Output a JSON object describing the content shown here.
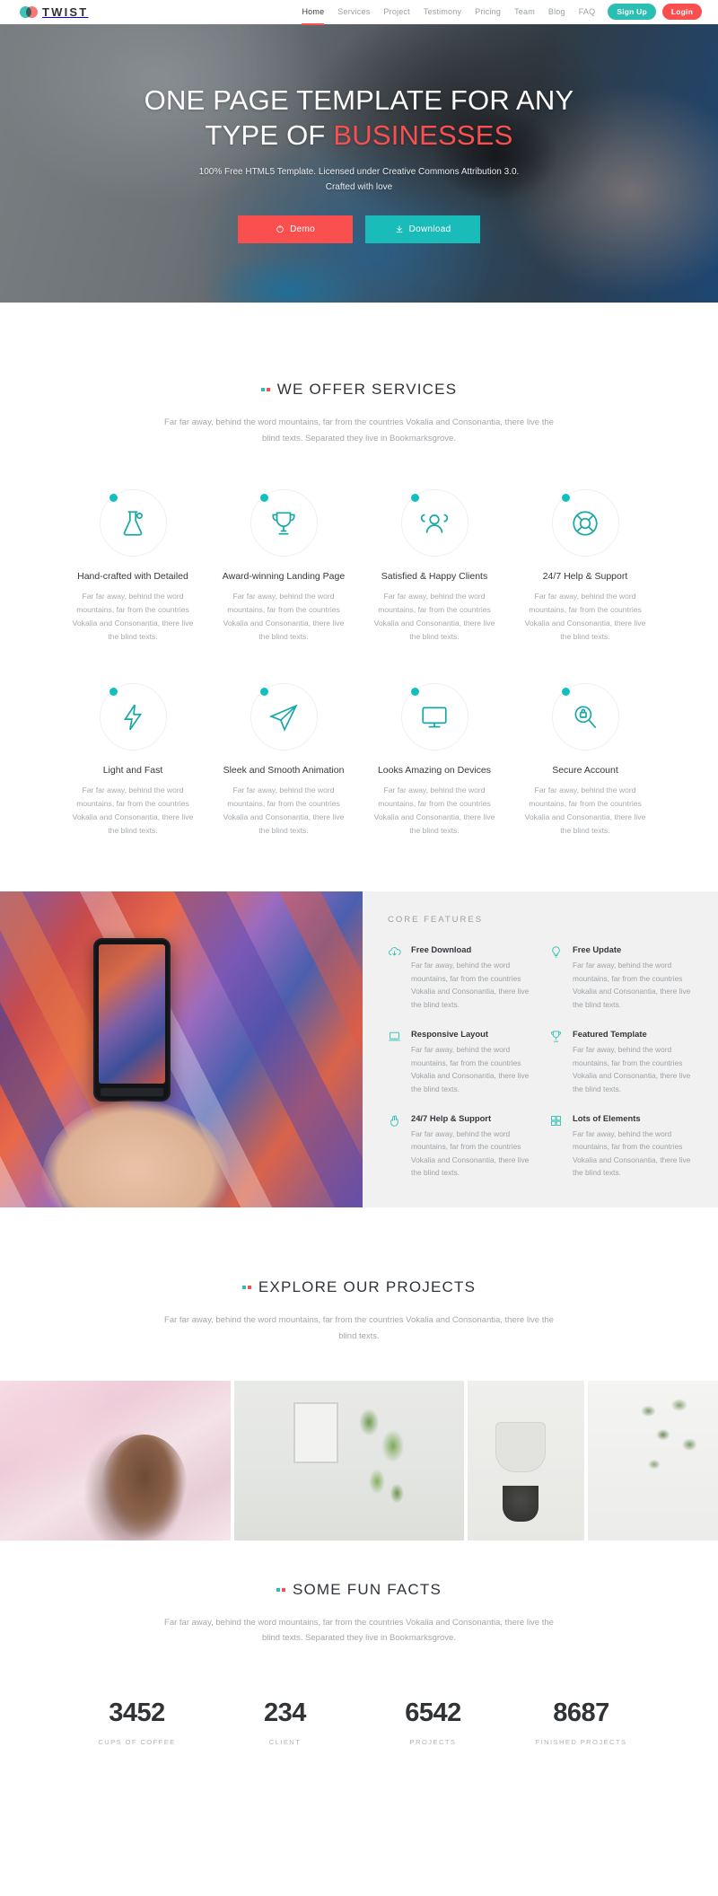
{
  "nav": {
    "brand": "TWIST",
    "links": [
      {
        "label": "Home",
        "active": true
      },
      {
        "label": "Services",
        "active": false
      },
      {
        "label": "Project",
        "active": false
      },
      {
        "label": "Testimony",
        "active": false
      },
      {
        "label": "Pricing",
        "active": false
      },
      {
        "label": "Team",
        "active": false
      },
      {
        "label": "Blog",
        "active": false
      },
      {
        "label": "FAQ",
        "active": false
      }
    ],
    "signup_label": "Sign Up",
    "login_label": "Login",
    "signup_color": "#2bbfb3",
    "login_color": "#f9504f"
  },
  "hero": {
    "title_line1": "ONE PAGE TEMPLATE FOR ANY",
    "title_line2_pre": "TYPE OF ",
    "title_line2_accent": "BUSINESSES",
    "sub_line1": "100% Free HTML5 Template. Licensed under Creative Commons Attribution 3.0.",
    "sub_line2": "Crafted with love",
    "demo_label": "Demo",
    "download_label": "Download",
    "demo_color": "#f9504f",
    "download_color": "#19bcb8"
  },
  "services": {
    "title": "WE OFFER SERVICES",
    "desc_line1": "Far far away, behind the word mountains, far from the countries Vokalia and Consonantia,",
    "desc_line2": "there live the blind texts. Separated they live in Bookmarksgrove.",
    "items": [
      {
        "icon": "flask-icon",
        "name": "Hand-crafted with Detailed",
        "text": "Far far away, behind the word mountains, far from the countries Vokalia and Consonantia, there live the blind texts."
      },
      {
        "icon": "trophy-icon",
        "name": "Award-winning Landing Page",
        "text": "Far far away, behind the word mountains, far from the countries Vokalia and Consonantia, there live the blind texts."
      },
      {
        "icon": "users-icon",
        "name": "Satisfied & Happy Clients",
        "text": "Far far away, behind the word mountains, far from the countries Vokalia and Consonantia, there live the blind texts."
      },
      {
        "icon": "lifebuoy-icon",
        "name": "24/7 Help & Support",
        "text": "Far far away, behind the word mountains, far from the countries Vokalia and Consonantia, there live the blind texts."
      },
      {
        "icon": "bolt-icon",
        "name": "Light and Fast",
        "text": "Far far away, behind the word mountains, far from the countries Vokalia and Consonantia, there live the blind texts."
      },
      {
        "icon": "paper-plane-icon",
        "name": "Sleek and Smooth Animation",
        "text": "Far far away, behind the word mountains, far from the countries Vokalia and Consonantia, there live the blind texts."
      },
      {
        "icon": "monitor-icon",
        "name": "Looks Amazing on Devices",
        "text": "Far far away, behind the word mountains, far from the countries Vokalia and Consonantia, there live the blind texts."
      },
      {
        "icon": "magnifier-lock-icon",
        "name": "Secure Account",
        "text": "Far far away, behind the word mountains, far from the countries Vokalia and Consonantia, there live the blind texts."
      }
    ]
  },
  "core": {
    "title": "CORE FEATURES",
    "features": [
      {
        "icon": "cloud-download-icon",
        "name": "Free Download",
        "text": "Far far away, behind the word mountains, far from the countries Vokalia and Consonantia, there live the blind texts."
      },
      {
        "icon": "bulb-icon",
        "name": "Free Update",
        "text": "Far far away, behind the word mountains, far from the countries Vokalia and Consonantia, there live the blind texts."
      },
      {
        "icon": "laptop-icon",
        "name": "Responsive Layout",
        "text": "Far far away, behind the word mountains, far from the countries Vokalia and Consonantia, there live the blind texts."
      },
      {
        "icon": "trophy-icon",
        "name": "Featured Template",
        "text": "Far far away, behind the word mountains, far from the countries Vokalia and Consonantia, there live the blind texts."
      },
      {
        "icon": "hand-icon",
        "name": "24/7 Help & Support",
        "text": "Far far away, behind the word mountains, far from the countries Vokalia and Consonantia, there live the blind texts."
      },
      {
        "icon": "grid-icon",
        "name": "Lots of Elements",
        "text": "Far far away, behind the word mountains, far from the countries Vokalia and Consonantia, there live the blind texts."
      }
    ]
  },
  "projects": {
    "title": "EXPLORE OUR PROJECTS",
    "desc_line1": "Far far away, behind the word mountains, far from the countries Vokalia and Consonantia,",
    "desc_line2": "there live the blind texts."
  },
  "facts": {
    "title": "SOME FUN FACTS",
    "desc_line1": "Far far away, behind the word mountains, far from the countries Vokalia and Consonantia,",
    "desc_line2": "there live the blind texts. Separated they live in Bookmarksgrove.",
    "items": [
      {
        "number": "3452",
        "label": "CUPS OF COFFEE"
      },
      {
        "number": "234",
        "label": "CLIENT"
      },
      {
        "number": "6542",
        "label": "PROJECTS"
      },
      {
        "number": "8687",
        "label": "FINISHED PROJECTS"
      }
    ]
  }
}
